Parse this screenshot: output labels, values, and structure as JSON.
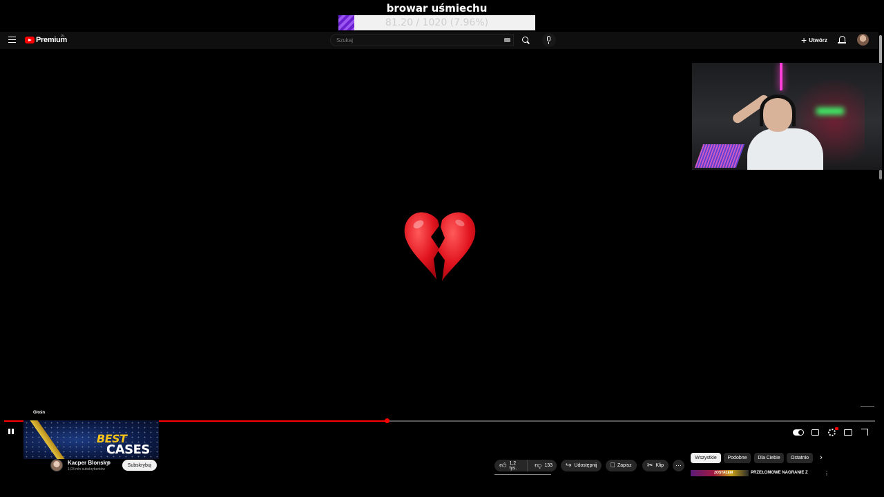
{
  "overlay": {
    "title": "browar uśmiechu",
    "goal_text": "81.20 / 1020 (7.96%)",
    "goal_progress_percent": 7.96,
    "goal_fill_color": "#7c3aed"
  },
  "header": {
    "brand": "Premium",
    "brand_region": "PL",
    "search_placeholder": "Szukaj",
    "create_label": "Utwórz",
    "icons": [
      "menu-icon",
      "youtube-logo-icon",
      "keyboard-icon",
      "search-icon",
      "mic-icon",
      "plus-icon",
      "bell-icon",
      "avatar"
    ]
  },
  "video": {
    "center_emoji": "💔",
    "progress_percent": 44,
    "progress_color": "#ff0000"
  },
  "hover_preview": {
    "volume_label": "Głośn",
    "thumb_line1": "BEST",
    "thumb_line2": "CASES"
  },
  "channel": {
    "name": "Kacper Blonsky",
    "subscribers": "1,03 mln subskrybentów",
    "subscribe_label": "Subskrybuj"
  },
  "actions": {
    "likes": "1,2 tys.",
    "dislikes": "133",
    "share": "Udostępnij",
    "save": "Zapisz",
    "clip": "Klip",
    "more": "⋯"
  },
  "chips": [
    "Wszystkie",
    "Podobne",
    "Dla Ciebie",
    "Ostatnio"
  ],
  "recommendation": {
    "thumb_text": "ZOSTAŁEM OSZUKANY",
    "title": "PRZEŁOMOWE NAGRANIE Z"
  }
}
